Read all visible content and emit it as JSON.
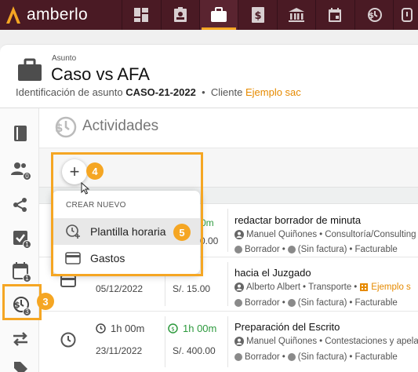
{
  "app": {
    "brand": "amberlo"
  },
  "topnav": {
    "items": [
      {
        "icon": "dashboard-icon"
      },
      {
        "icon": "contacts-icon"
      },
      {
        "icon": "briefcase-icon",
        "active": true
      },
      {
        "icon": "invoice-icon"
      },
      {
        "icon": "bank-icon"
      },
      {
        "icon": "calendar-icon"
      },
      {
        "icon": "time-money-icon"
      },
      {
        "icon": "alert-icon"
      }
    ]
  },
  "header": {
    "subject_label": "Asunto",
    "title": "Caso vs AFA",
    "ident_label": "Identificación de asunto",
    "ident_value": "CASO-21-2022",
    "separator": "•",
    "client_label": "Cliente",
    "client_value": "Ejemplo sac"
  },
  "sidebar": {
    "items": [
      {
        "icon": "book-icon"
      },
      {
        "icon": "people-icon",
        "badge": "0"
      },
      {
        "icon": "share-icon"
      },
      {
        "icon": "task-check-icon",
        "badge": "1"
      },
      {
        "icon": "calendar-icon",
        "badge": "1"
      },
      {
        "icon": "time-money-icon",
        "badge": "3",
        "active": true
      },
      {
        "icon": "transfer-icon"
      },
      {
        "icon": "tag-icon"
      }
    ]
  },
  "activities": {
    "title": "Activ​idades",
    "rows": [
      {
        "type_icon": "clock-icon",
        "duration": "",
        "date": "",
        "billable_duration": "0m",
        "amount": "0.00",
        "description": "redactar borrador de minuta",
        "user": "Manuel Quiñones",
        "category": "Consultoría/Consulting",
        "status": "Borrador",
        "invoice": "(Sin factura)",
        "billing": "Facturable"
      },
      {
        "type_icon": "card-icon",
        "date": "05/12/2022",
        "amount": "S/. 15.00",
        "description": "hacia el Juzgado",
        "user": "Alberto Albert",
        "category": "Transporte",
        "extra": "Ejemplo s",
        "status": "Borrador",
        "invoice": "(Sin factura)",
        "billing": "Facturable"
      },
      {
        "type_icon": "clock-icon",
        "duration": "1h 00m",
        "date": "23/11/2022",
        "billable_duration": "1h 00m",
        "amount": "S/. 400.00",
        "description": "Preparación del Escrito",
        "user": "Manuel Quiñones",
        "category": "Contestaciones y apela",
        "status": "Borrador",
        "invoice": "(Sin factura)",
        "billing": "Facturable"
      }
    ]
  },
  "menu": {
    "title": "CREAR NUEVO",
    "items": [
      {
        "label": "Plantilla horaria",
        "icon": "clock-plus-icon"
      },
      {
        "label": "Gastos",
        "icon": "card-icon"
      }
    ]
  },
  "add_button": {
    "symbol": "+"
  },
  "annotations": {
    "step3": "3",
    "step4": "4",
    "step5": "5"
  },
  "colors": {
    "topbar": "#4a1a24",
    "accent": "#f5a623",
    "client": "#e68a00",
    "billable": "#2e9a3e"
  }
}
